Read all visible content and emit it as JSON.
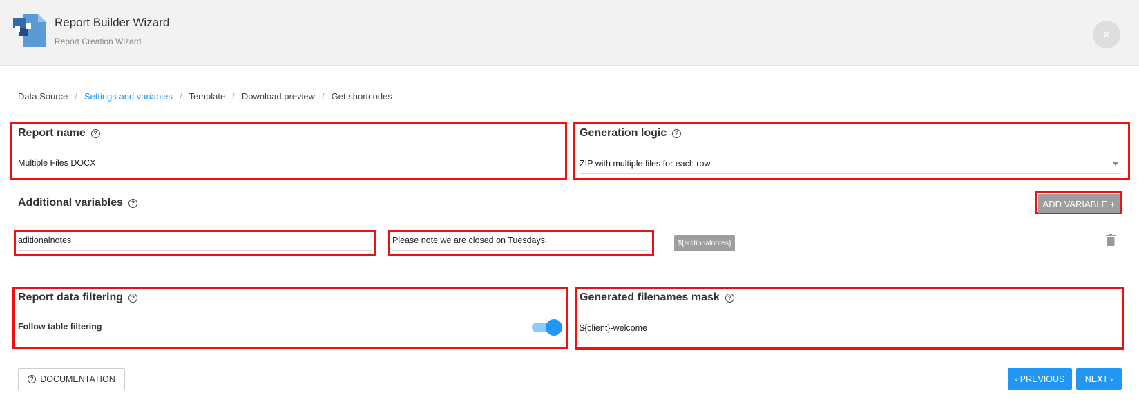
{
  "header": {
    "title": "Report Builder Wizard",
    "subtitle": "Report Creation Wizard",
    "close_label": "×"
  },
  "breadcrumb": {
    "items": [
      {
        "label": "Data Source",
        "active": false
      },
      {
        "label": "Settings and variables",
        "active": true
      },
      {
        "label": "Template",
        "active": false
      },
      {
        "label": "Download preview",
        "active": false
      },
      {
        "label": "Get shortcodes",
        "active": false
      }
    ],
    "separator": "/"
  },
  "report_name": {
    "label": "Report name",
    "value": "Multiple Files DOCX"
  },
  "generation_logic": {
    "label": "Generation logic",
    "value": "ZIP with multiple files for each row"
  },
  "additional_variables": {
    "label": "Additional variables",
    "add_button": "ADD VARIABLE +",
    "rows": [
      {
        "name": "aditionalnotes",
        "value": "Please note we are closed on Tuesdays.",
        "shortcode": "${aditionalnotes}"
      }
    ]
  },
  "report_data_filtering": {
    "label": "Report data filtering",
    "toggle_label": "Follow table filtering",
    "toggle_on": true
  },
  "filenames_mask": {
    "label": "Generated filenames mask",
    "value": "${client}-welcome"
  },
  "footer": {
    "documentation": "DOCUMENTATION",
    "previous": "PREVIOUS",
    "next": "NEXT"
  },
  "colors": {
    "accent": "#2196f3",
    "highlight_box": "#ee1111",
    "grey_button": "#9e9e9e"
  }
}
